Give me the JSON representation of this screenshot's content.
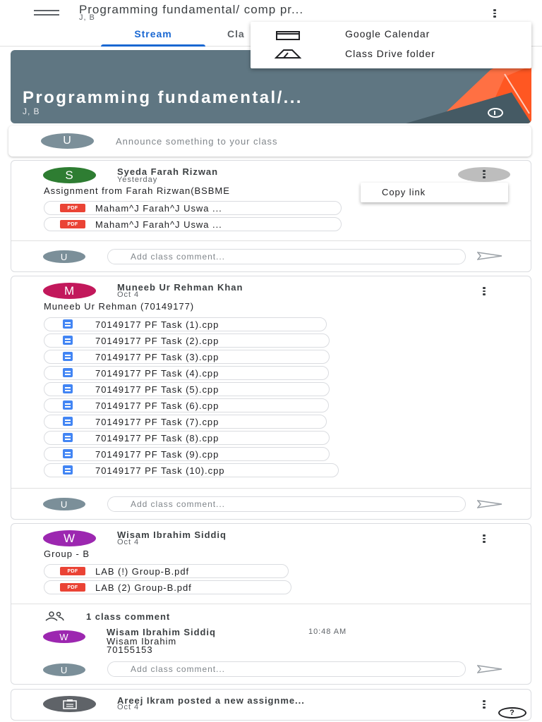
{
  "topbar": {
    "title": "Programming fundamental/ comp pr...",
    "subtitle": "J, B",
    "tabs": [
      {
        "label": "Stream"
      },
      {
        "label": "Cla"
      }
    ]
  },
  "overflow_menu": {
    "items": [
      {
        "label": "Google Calendar",
        "icon": "calendar-icon"
      },
      {
        "label": "Class Drive folder",
        "icon": "drive-icon"
      }
    ]
  },
  "banner": {
    "title": "Programming fundamental/...",
    "subtitle": "J, B",
    "color": "#5f7682"
  },
  "announce": {
    "avatar_letter": "U",
    "placeholder": "Announce something to your class"
  },
  "context_menu": {
    "copy_link": "Copy link"
  },
  "posts": [
    {
      "avatar_letter": "S",
      "avatar_color": "#2e7d32",
      "author": "Syeda Farah Rizwan",
      "date": "Yesterday",
      "text": "Assignment from Farah Rizwan(BSBME",
      "attachments": [
        {
          "name": "Maham^J Farah^J Uswa ...",
          "type": "pdf"
        },
        {
          "name": "Maham^J Farah^J Uswa ...",
          "type": "pdf"
        }
      ],
      "comment_placeholder": "Add class comment...",
      "user_letter": "U"
    },
    {
      "avatar_letter": "M",
      "avatar_color": "#c2185b",
      "author": "Muneeb Ur Rehman Khan",
      "date": "Oct 4",
      "text": "Muneeb Ur Rehman (70149177)",
      "attachments": [
        {
          "name": "70149177 PF Task (1).cpp",
          "type": "doc"
        },
        {
          "name": "70149177 PF Task (2).cpp",
          "type": "doc"
        },
        {
          "name": "70149177 PF Task (3).cpp",
          "type": "doc"
        },
        {
          "name": "70149177 PF Task (4).cpp",
          "type": "doc"
        },
        {
          "name": "70149177 PF Task (5).cpp",
          "type": "doc"
        },
        {
          "name": "70149177 PF Task (6).cpp",
          "type": "doc"
        },
        {
          "name": "70149177 PF Task (7).cpp",
          "type": "doc"
        },
        {
          "name": "70149177 PF Task (8).cpp",
          "type": "doc"
        },
        {
          "name": "70149177 PF Task (9).cpp",
          "type": "doc"
        },
        {
          "name": "70149177 PF Task (10).cpp",
          "type": "doc"
        }
      ],
      "comment_placeholder": "Add class comment...",
      "user_letter": "U"
    },
    {
      "avatar_letter": "W",
      "avatar_color": "#9c27b0",
      "author": "Wisam Ibrahim Siddiq",
      "date": "Oct 4",
      "text": "Group - B",
      "attachments": [
        {
          "name": "LAB (!) Group-B.pdf",
          "type": "pdf"
        },
        {
          "name": "LAB (2) Group-B.pdf",
          "type": "pdf"
        }
      ],
      "comment_count": "1 class comment",
      "comment": {
        "avatar_letter": "W",
        "author": "Wisam Ibrahim Siddiq",
        "time": "10:48 AM",
        "line1": "Wisam Ibrahim",
        "line2": "70155153"
      },
      "comment_placeholder": "Add class comment...",
      "user_letter": "U"
    },
    {
      "author": "Areej Ikram posted a new assignme...",
      "date": "Oct 4",
      "icon": "assignment-icon"
    }
  ],
  "help": {
    "label": "?"
  }
}
